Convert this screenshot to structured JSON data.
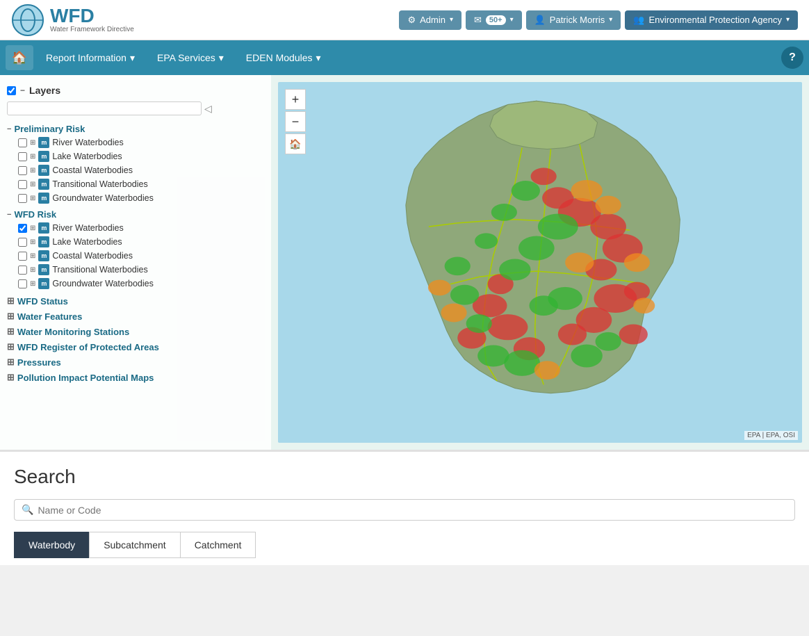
{
  "header": {
    "logo_wfd": "WFD",
    "logo_subtitle": "Water Framework Directive",
    "admin_label": "Admin",
    "notify_count": "50+",
    "user_label": "Patrick Morris",
    "org_label": "Environmental Protection Agency"
  },
  "nav": {
    "home_title": "Home",
    "report_information": "Report Information",
    "epa_services": "EPA Services",
    "eden_modules": "EDEN Modules",
    "help_title": "Help"
  },
  "layers": {
    "title": "Layers",
    "groups": [
      {
        "name": "Preliminary Risk",
        "items": [
          {
            "label": "River Waterbodies",
            "checked": false
          },
          {
            "label": "Lake Waterbodies",
            "checked": false
          },
          {
            "label": "Coastal Waterbodies",
            "checked": false
          },
          {
            "label": "Transitional Waterbodies",
            "checked": false
          },
          {
            "label": "Groundwater Waterbodies",
            "checked": false
          }
        ]
      },
      {
        "name": "WFD Risk",
        "items": [
          {
            "label": "River Waterbodies",
            "checked": true
          },
          {
            "label": "Lake Waterbodies",
            "checked": false
          },
          {
            "label": "Coastal Waterbodies",
            "checked": false
          },
          {
            "label": "Transitional Waterbodies",
            "checked": false
          },
          {
            "label": "Groundwater Waterbodies",
            "checked": false
          }
        ]
      }
    ],
    "sections": [
      {
        "label": "WFD Status"
      },
      {
        "label": "Water Features"
      },
      {
        "label": "Water Monitoring Stations"
      },
      {
        "label": "WFD Register of Protected Areas"
      },
      {
        "label": "Pressures"
      },
      {
        "label": "Pollution Impact Potential Maps"
      }
    ]
  },
  "map": {
    "attribution": "EPA | EPA, OSI",
    "zoom_in": "+",
    "zoom_out": "−"
  },
  "search": {
    "title": "Search",
    "placeholder": "Name or Code",
    "tabs": [
      {
        "label": "Waterbody",
        "active": true
      },
      {
        "label": "Subcatchment",
        "active": false
      },
      {
        "label": "Catchment",
        "active": false
      }
    ]
  }
}
